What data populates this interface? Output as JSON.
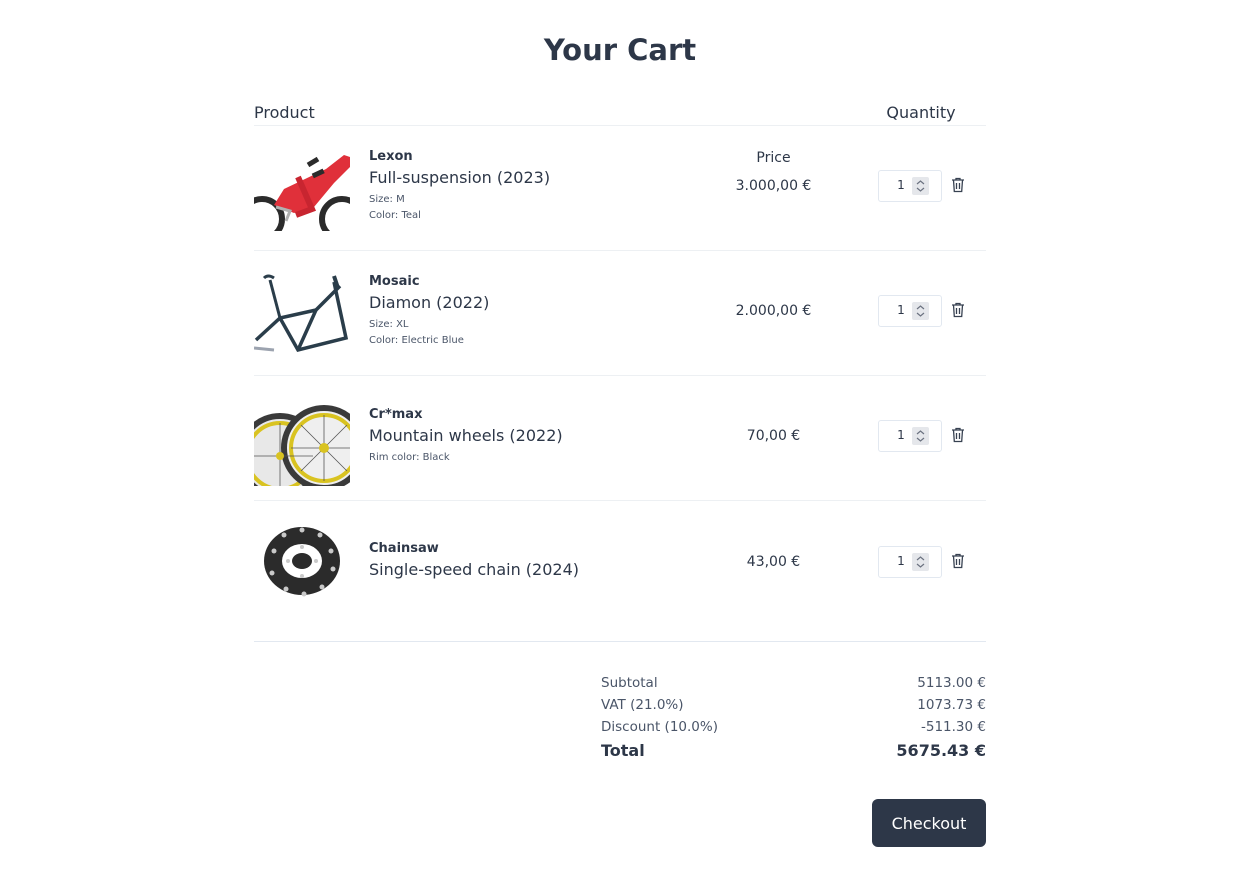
{
  "page": {
    "title": "Your Cart"
  },
  "table": {
    "headers": {
      "product": "Product",
      "price": "Price",
      "quantity": "Quantity"
    }
  },
  "items": [
    {
      "brand": "Lexon",
      "name": "Full-suspension (2023)",
      "attributes": [
        "Size: M",
        "Color: Teal"
      ],
      "price": "3.000,00 €",
      "quantity": "1",
      "thumbnail_icon": "full-suspension-bike-icon"
    },
    {
      "brand": "Mosaic",
      "name": "Diamon (2022)",
      "attributes": [
        "Size: XL",
        "Color: Electric Blue"
      ],
      "price": "2.000,00 €",
      "quantity": "1",
      "thumbnail_icon": "bike-frame-icon"
    },
    {
      "brand": "Cr*max",
      "name": "Mountain wheels (2022)",
      "attributes": [
        "Rim color: Black"
      ],
      "price": "70,00 €",
      "quantity": "1",
      "thumbnail_icon": "wheels-icon"
    },
    {
      "brand": "Chainsaw",
      "name": "Single-speed chain (2024)",
      "attributes": [],
      "price": "43,00 €",
      "quantity": "1",
      "thumbnail_icon": "chain-icon"
    }
  ],
  "summary": {
    "subtotal_label": "Subtotal",
    "subtotal_value": "5113.00 €",
    "vat_label": "VAT (21.0%)",
    "vat_value": "1073.73 €",
    "discount_label": "Discount (10.0%)",
    "discount_value": "-511.30 €",
    "total_label": "Total",
    "total_value": "5675.43 €"
  },
  "checkout": {
    "label": "Checkout"
  },
  "colors": {
    "text": "#2d3748",
    "button_bg": "#2d3748",
    "frame_red": "#e0303a",
    "frame_dark": "#2a3d4a",
    "rim_yellow": "#d9c321"
  }
}
